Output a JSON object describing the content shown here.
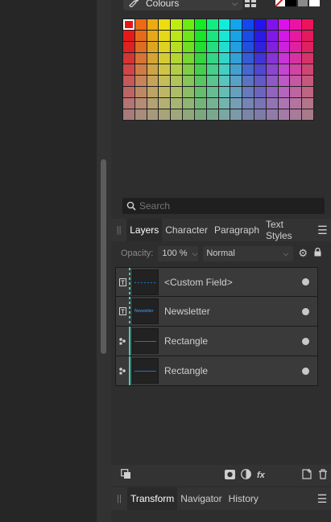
{
  "colour_panel": {
    "mode_label": "Colours",
    "swatch_colors": {
      "none": "#ffffff",
      "black": "#000000",
      "grey": "#8a8a8a",
      "white": "#ffffff"
    },
    "palette": {
      "hues": [
        0,
        24,
        42,
        56,
        72,
        95,
        125,
        150,
        175,
        200,
        225,
        245,
        270,
        295,
        320,
        340
      ],
      "sat_levels": [
        85,
        80,
        74,
        66,
        58,
        48,
        40,
        30,
        20
      ],
      "light_levels": [
        50,
        50,
        50,
        52,
        54,
        56,
        57,
        58,
        57
      ],
      "selected": 0
    },
    "search_placeholder": "Search"
  },
  "layers_panel": {
    "tabs": [
      "Layers",
      "Character",
      "Paragraph",
      "Text Styles"
    ],
    "active_tab": "Layers",
    "opacity_label": "Opacity:",
    "opacity_value": "100 %",
    "blend_mode": "Normal",
    "layers": [
      {
        "name": "<Custom Field>",
        "type": "text-frame-icon"
      },
      {
        "name": "Newsletter",
        "type": "text-frame-icon",
        "thumb_text": "Newsletter"
      },
      {
        "name": "Rectangle",
        "type": "shape-icon"
      },
      {
        "name": "Rectangle",
        "type": "shape-icon"
      }
    ]
  },
  "bottom_tabs": {
    "tabs": [
      "Transform",
      "Navigator",
      "History"
    ],
    "active_tab": "Transform"
  },
  "colors": {
    "accent": "#3fd3b8",
    "selection_line": "#1e74c8"
  }
}
